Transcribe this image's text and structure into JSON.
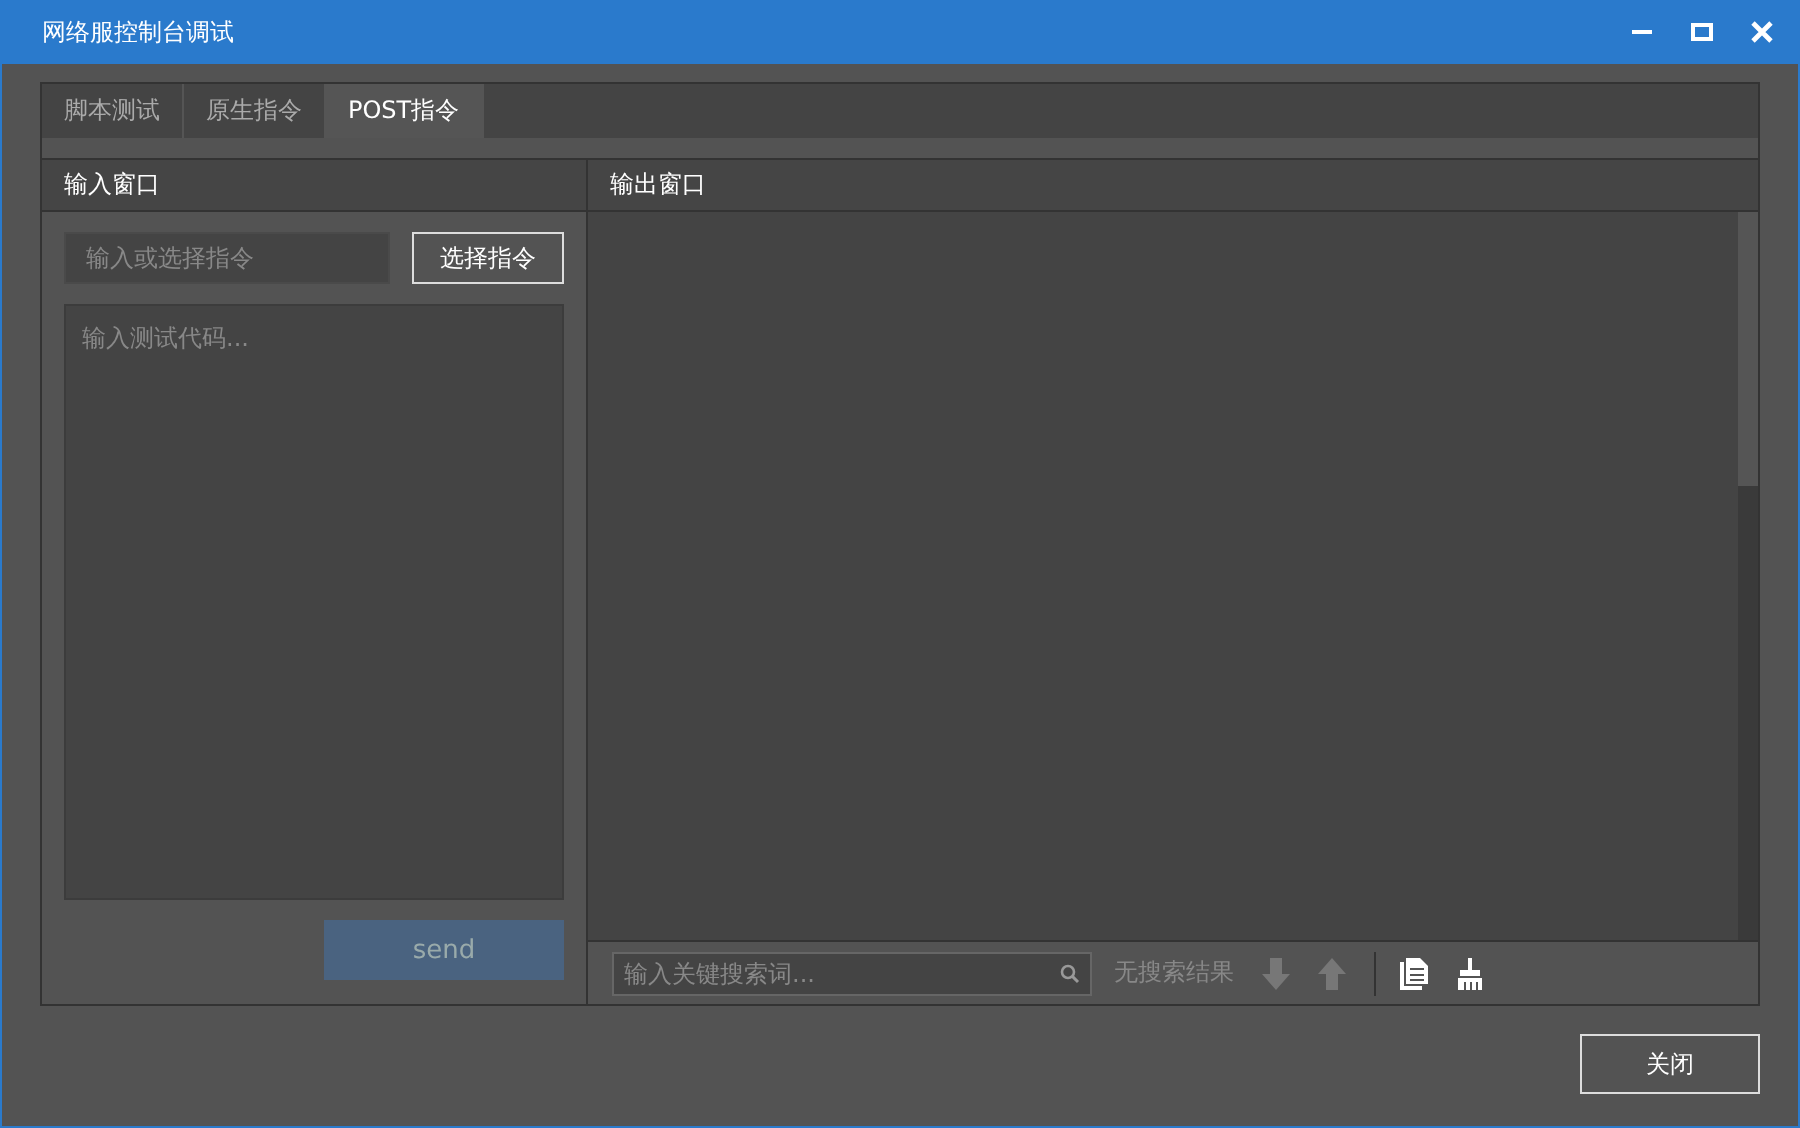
{
  "window": {
    "title": "网络服控制台调试"
  },
  "tabs": [
    {
      "label": "脚本测试",
      "selected": false
    },
    {
      "label": "原生指令",
      "selected": false
    },
    {
      "label": "POST指令",
      "selected": true
    }
  ],
  "input_panel": {
    "title": "输入窗口",
    "command": {
      "placeholder": "输入或选择指令"
    },
    "choose_button": "选择指令",
    "code": {
      "placeholder": "输入测试代码..."
    },
    "send_button": {
      "label": "send",
      "disabled": true
    }
  },
  "output_panel": {
    "title": "输出窗口",
    "search": {
      "placeholder": "输入关键搜索词..."
    },
    "search_status": "无搜索结果",
    "tools": [
      {
        "kind": "down",
        "disabled": true
      },
      {
        "kind": "up",
        "disabled": true
      },
      {
        "kind": "copy",
        "disabled": false
      },
      {
        "kind": "clear",
        "disabled": false
      }
    ]
  },
  "close_button": "关闭"
}
